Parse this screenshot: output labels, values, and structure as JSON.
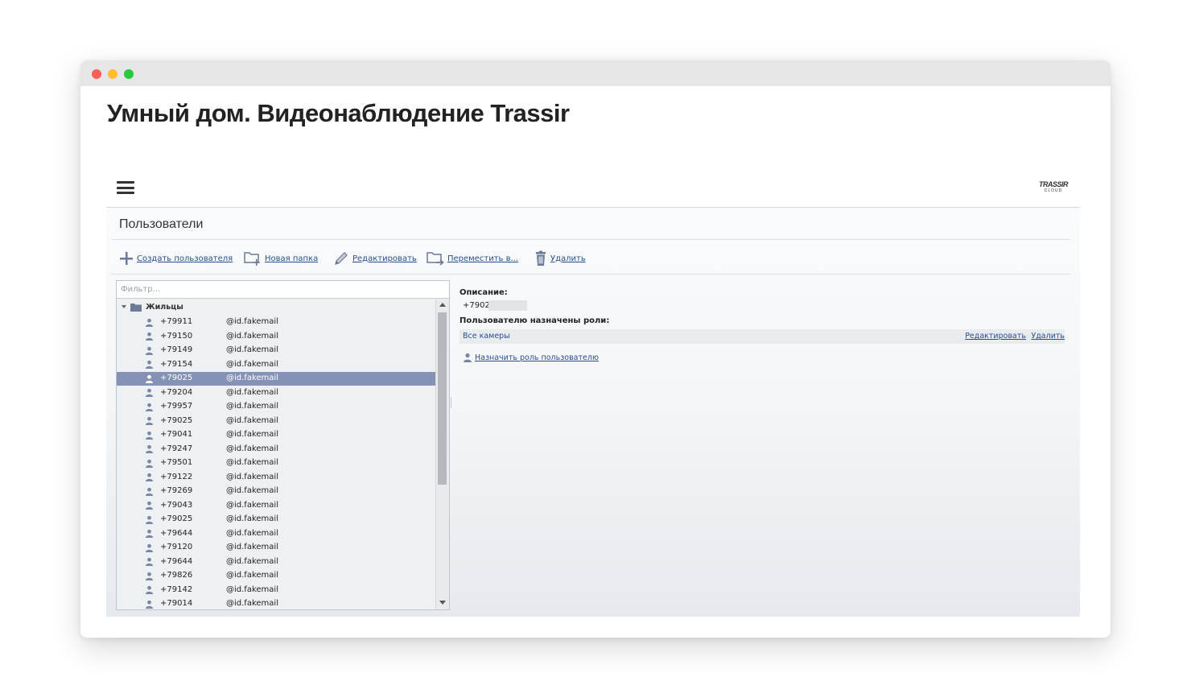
{
  "page": {
    "title": "Умный дом. Видеонаблюдение Trassir"
  },
  "app": {
    "logo": {
      "line1": "TRASSIR",
      "line2": "CLOUD"
    },
    "section_title": "Пользователи",
    "toolbar": {
      "create_user": "Создать пользователя",
      "new_folder": "Новая папка",
      "edit": "Редактировать",
      "move": "Переместить в...",
      "delete": "Удалить"
    },
    "filter": {
      "placeholder": "Фильтр...",
      "value": ""
    },
    "tree": {
      "folder": "Жильцы",
      "users": [
        {
          "phone": "+79911",
          "email": "@id.fakemail"
        },
        {
          "phone": "+79150",
          "email": "@id.fakemail"
        },
        {
          "phone": "+79149",
          "email": "@id.fakemail"
        },
        {
          "phone": "+79154",
          "email": "@id.fakemail"
        },
        {
          "phone": "+79025",
          "email": "@id.fakemail",
          "selected": true
        },
        {
          "phone": "+79204",
          "email": "@id.fakemail"
        },
        {
          "phone": "+79957",
          "email": "@id.fakemail"
        },
        {
          "phone": "+79025",
          "email": "@id.fakemail"
        },
        {
          "phone": "+79041",
          "email": "@id.fakemail"
        },
        {
          "phone": "+79247",
          "email": "@id.fakemail"
        },
        {
          "phone": "+79501",
          "email": "@id.fakemail"
        },
        {
          "phone": "+79122",
          "email": "@id.fakemail"
        },
        {
          "phone": "+79269",
          "email": "@id.fakemail"
        },
        {
          "phone": "+79043",
          "email": "@id.fakemail"
        },
        {
          "phone": "+79025",
          "email": "@id.fakemail"
        },
        {
          "phone": "+79644",
          "email": "@id.fakemail"
        },
        {
          "phone": "+79120",
          "email": "@id.fakemail"
        },
        {
          "phone": "+79644",
          "email": "@id.fakemail"
        },
        {
          "phone": "+79826",
          "email": "@id.fakemail"
        },
        {
          "phone": "+79142",
          "email": "@id.fakemail"
        },
        {
          "phone": "+79014",
          "email": "@id.fakemail"
        }
      ]
    },
    "details": {
      "description_label": "Описание:",
      "description_value": "+7902",
      "roles_label": "Пользователю назначены роли:",
      "roles": [
        {
          "name": "Все камеры",
          "edit": "Редактировать",
          "delete": "Удалить"
        }
      ],
      "assign_role": "Назначить роль пользователю"
    }
  },
  "colors": {
    "link": "#2a4d8f",
    "selected_row": "#8592b5",
    "titlebar": "#e6e6e6"
  }
}
